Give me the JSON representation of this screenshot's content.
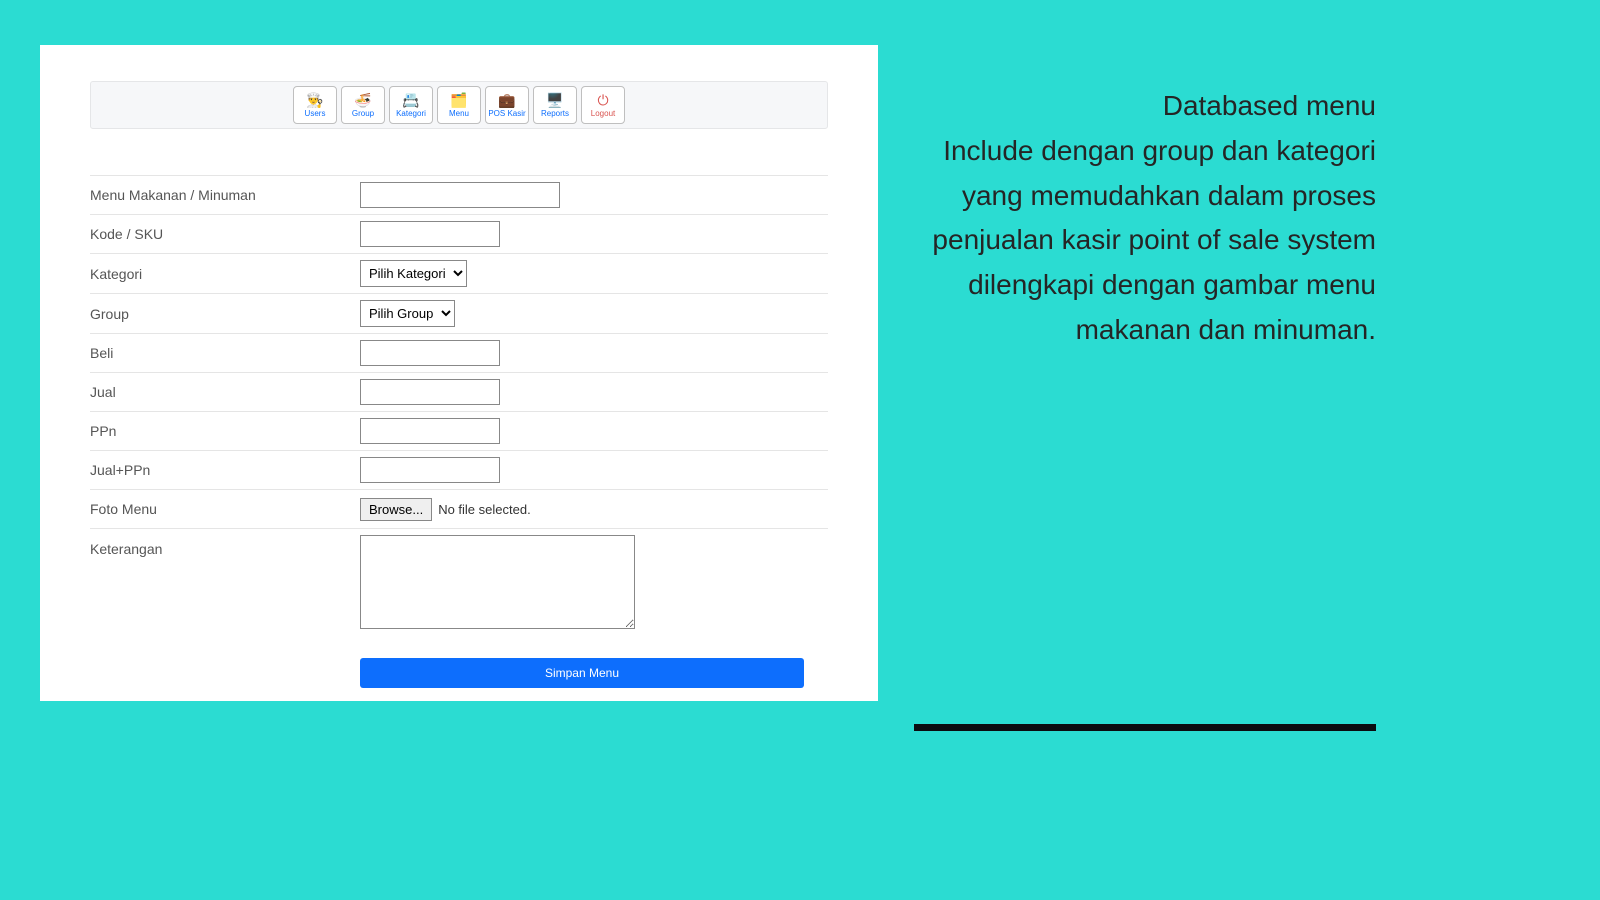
{
  "nav": [
    {
      "label": "Users",
      "icon": "👨‍🍳",
      "name": "nav-users"
    },
    {
      "label": "Group",
      "icon": "🍜",
      "name": "nav-group"
    },
    {
      "label": "Kategori",
      "icon": "📇",
      "name": "nav-kategori"
    },
    {
      "label": "Menu",
      "icon": "🗂️",
      "name": "nav-menu"
    },
    {
      "label": "POS Kasir",
      "icon": "💼",
      "name": "nav-pos-kasir"
    },
    {
      "label": "Reports",
      "icon": "🖥️",
      "name": "nav-reports"
    },
    {
      "label": "Logout",
      "icon": "⏻",
      "name": "nav-logout",
      "logout": true
    }
  ],
  "form": {
    "fields": {
      "menu_makanan": {
        "label": "Menu Makanan / Minuman",
        "value": ""
      },
      "kode_sku": {
        "label": "Kode / SKU",
        "value": ""
      },
      "kategori": {
        "label": "Kategori",
        "selected": "Pilih Kategori",
        "options": [
          "Pilih Kategori"
        ]
      },
      "group": {
        "label": "Group",
        "selected": "Pilih Group",
        "options": [
          "Pilih Group"
        ]
      },
      "beli": {
        "label": "Beli",
        "value": ""
      },
      "jual": {
        "label": "Jual",
        "value": ""
      },
      "ppn": {
        "label": "PPn",
        "value": ""
      },
      "jual_ppn": {
        "label": "Jual+PPn",
        "value": ""
      },
      "foto_menu": {
        "label": "Foto Menu",
        "browse": "Browse...",
        "no_file": "No file selected."
      },
      "keterangan": {
        "label": "Keterangan",
        "value": ""
      }
    },
    "submit": "Simpan Menu"
  },
  "description": {
    "title": "Databased menu",
    "body": "Include dengan group dan kategori yang memudahkan dalam proses penjualan kasir point of sale system dilengkapi dengan gambar menu makanan dan minuman."
  }
}
